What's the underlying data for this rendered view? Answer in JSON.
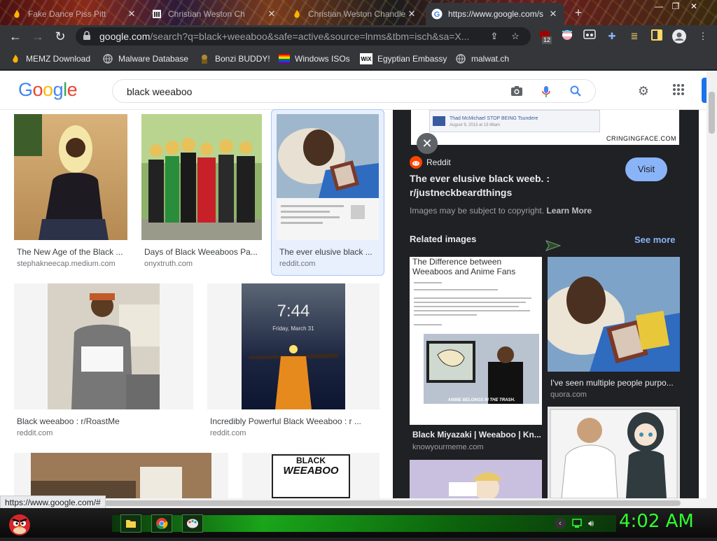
{
  "tabs": [
    {
      "label": "Fake Dance Piss Pitt",
      "icon": "flame-favicon-icon"
    },
    {
      "label": "Christian Weston Ch",
      "icon": "building-favicon-icon"
    },
    {
      "label": "Christian Weston Chandler",
      "icon": "flame-favicon-icon"
    },
    {
      "label": "https://www.google.com/s",
      "icon": "google-favicon-icon",
      "active": true
    }
  ],
  "toolbar": {
    "url_host": "google.com",
    "url_rest": "/search?q=black+weeaboo&safe=active&source=lnms&tbm=isch&sa=X...",
    "ublock_badge": "12"
  },
  "bookmarks": [
    {
      "label": "MEMZ Download",
      "icon": "flame-icon"
    },
    {
      "label": "Malware Database",
      "icon": "globe-icon"
    },
    {
      "label": "Bonzi BUDDY!",
      "icon": "bonzi-icon"
    },
    {
      "label": "Windows ISOs",
      "icon": "rainbow-icon"
    },
    {
      "label": "Egyptian Embassy",
      "icon": "wix-icon"
    },
    {
      "label": "malwat.ch",
      "icon": "globe-icon"
    }
  ],
  "google": {
    "logo": "Google",
    "query": "black weeaboo"
  },
  "results": [
    {
      "caption": "The New Age of the Black ...",
      "source": "stephakneecap.medium.com"
    },
    {
      "caption": "Days of Black Weeaboos Pa...",
      "source": "onyxtruth.com"
    },
    {
      "caption": "The ever elusive black ...",
      "source": "reddit.com"
    },
    {
      "caption": "Black weeaboo : r/RoastMe",
      "source": "reddit.com"
    },
    {
      "caption": "Incredibly Powerful Black Weeaboo : r ...",
      "source": "reddit.com"
    }
  ],
  "result_imgtext": {
    "lock_time": "7:44",
    "lock_date": "Friday, March 31",
    "poster_line1": "BLACK",
    "poster_line2": "WEEABOO"
  },
  "panel": {
    "top_img_text": "CRINGINGFACE.COM",
    "top_img_line1": "Thad McMichael STOP BEING Tsundere",
    "top_img_line2": "August 9, 2013 at 13:48am",
    "site": "Reddit",
    "title": "The ever elusive black weeb. : r/justneckbeardthings",
    "visit_label": "Visit",
    "copyright": "Images may be subject to copyright.",
    "learn_more": "Learn More",
    "related_heading": "Related images",
    "see_more": "See more",
    "related": [
      {
        "caption": "Black Miyazaki | Weeaboo | Kn...",
        "source": "knowyourmeme.com",
        "img_title": "The Difference between Weeaboos and Anime Fans",
        "img_foot": "ANIME BELONGS IN THE TRASH."
      },
      {
        "caption": "I've seen multiple people purpo...",
        "source": "quora.com"
      }
    ]
  },
  "status_url": "https://www.google.com/#",
  "clock": "4:02 AM",
  "colors": {
    "accent": "#1a73e8",
    "panel_bg": "#202124",
    "clock_green": "#2eff2e"
  }
}
